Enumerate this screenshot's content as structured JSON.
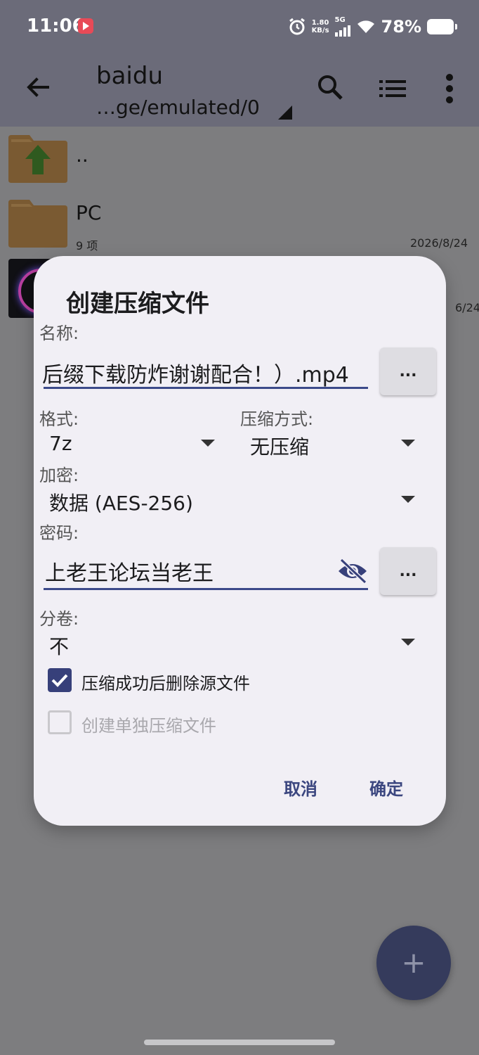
{
  "status": {
    "time": "11:06",
    "speed_value": "1.80",
    "speed_unit": "KB/s",
    "network": "5G",
    "battery": "78%"
  },
  "appbar": {
    "title": "baidu",
    "path": "…ge/emulated/0"
  },
  "files": [
    {
      "name": "..",
      "sub": "",
      "date": ""
    },
    {
      "name": "PC",
      "sub": "9 项",
      "date": "2026/8/24"
    }
  ],
  "partial_date": "6/24",
  "dialog": {
    "title": "创建压缩文件",
    "name_label": "名称:",
    "name_value": "后缀下载防炸谢谢配合！）.mp4",
    "name_btn": "...",
    "format_label": "格式:",
    "format_value": "7z",
    "method_label": "压缩方式:",
    "method_value": "无压缩",
    "encrypt_label": "加密:",
    "encrypt_value": "数据 (AES-256)",
    "password_label": "密码:",
    "password_value": "上老王论坛当老王",
    "password_btn": "...",
    "split_label": "分卷:",
    "split_value": "不",
    "delete_source_label": "压缩成功后删除源文件",
    "delete_source_checked": true,
    "separate_label": "创建单独压缩文件",
    "separate_checked": false,
    "cancel": "取消",
    "ok": "确定"
  },
  "fab_label": "+",
  "colors": {
    "accent": "#37407a",
    "dialog_bg": "#f1eff5",
    "folder": "#e0a030",
    "folder_arrow": "#2f7d1f"
  }
}
